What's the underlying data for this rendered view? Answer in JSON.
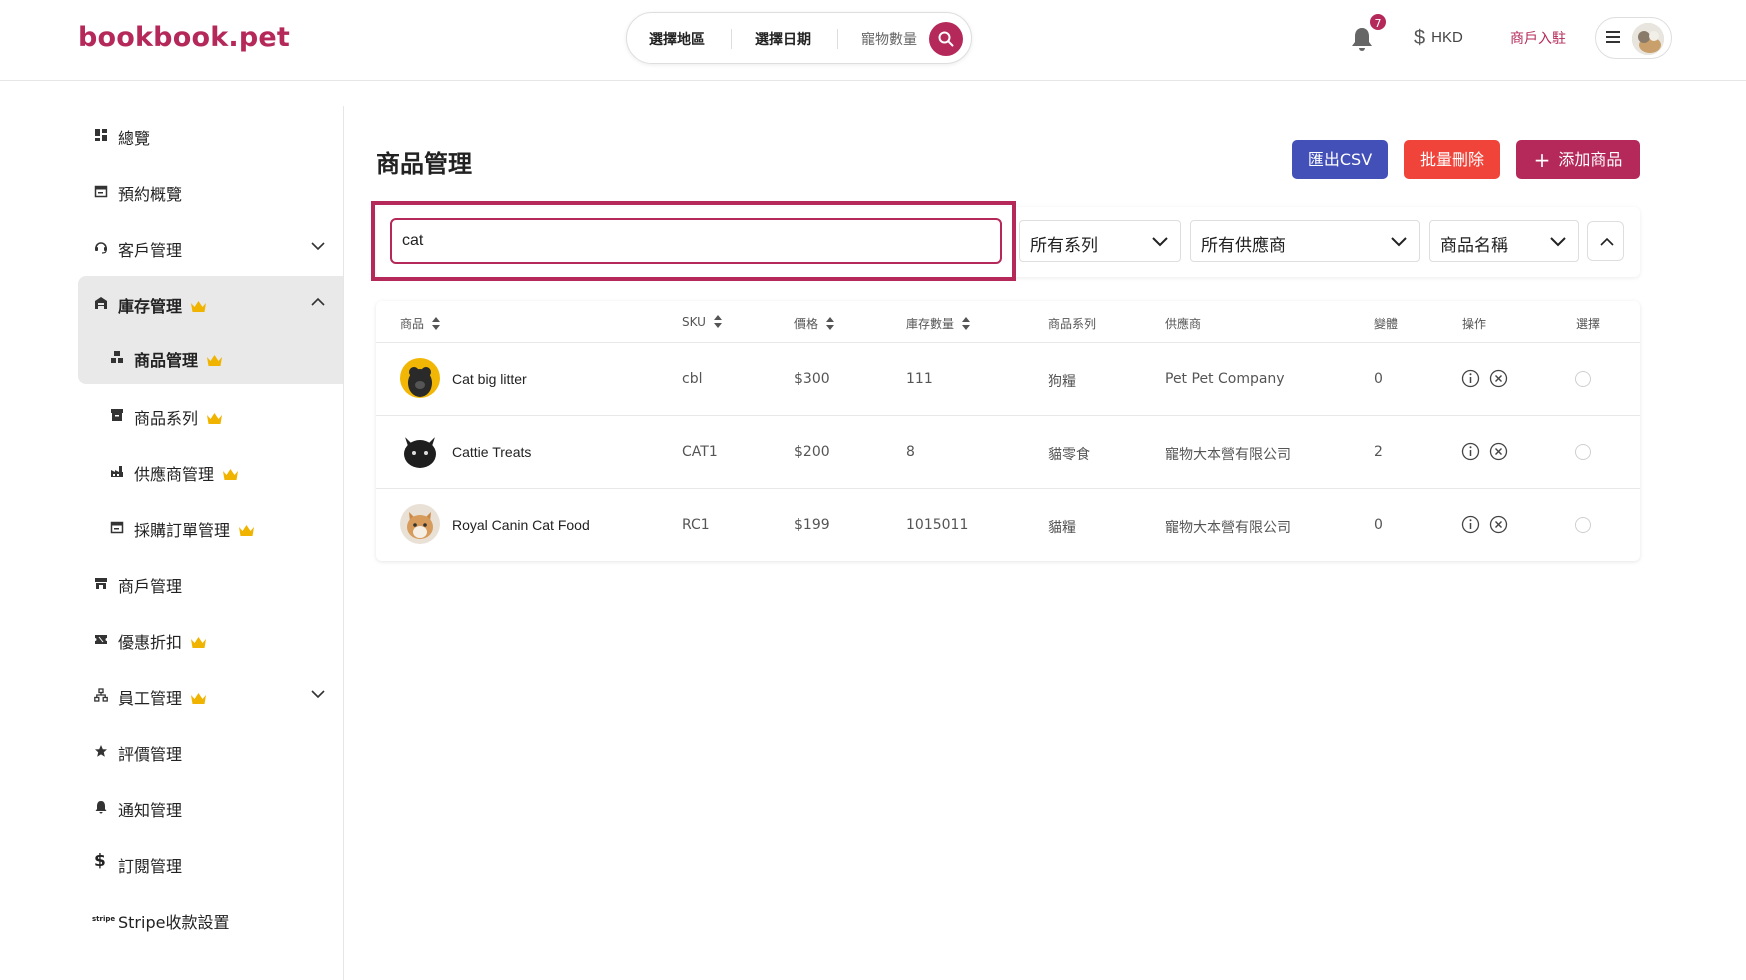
{
  "header": {
    "logo": "bookbook.pet",
    "search": {
      "region_label": "選擇地區",
      "date_label": "選擇日期",
      "pets_label": "寵物數量"
    },
    "notification_count": "7",
    "currency": "HKD",
    "merchant_link": "商戶入駐"
  },
  "sidebar": {
    "items": [
      {
        "label": "總覽",
        "icon": "dashboard-icon"
      },
      {
        "label": "預約概覽",
        "icon": "calendar-icon"
      },
      {
        "label": "客戶管理",
        "icon": "headset-icon"
      },
      {
        "label": "庫存管理",
        "icon": "warehouse-icon"
      },
      {
        "label": "商品管理",
        "icon": "boxes-icon"
      },
      {
        "label": "商品系列",
        "icon": "archive-icon"
      },
      {
        "label": "供應商管理",
        "icon": "factory-icon"
      },
      {
        "label": "採購訂單管理",
        "icon": "calendar-icon"
      },
      {
        "label": "商戶管理",
        "icon": "store-icon"
      },
      {
        "label": "優惠折扣",
        "icon": "ticket-icon"
      },
      {
        "label": "員工管理",
        "icon": "org-chart-icon"
      },
      {
        "label": "評價管理",
        "icon": "star-icon"
      },
      {
        "label": "通知管理",
        "icon": "bell-icon"
      },
      {
        "label": "訂閱管理",
        "icon": "dollar-icon"
      },
      {
        "label": "Stripe收款設置",
        "icon": "stripe-icon"
      }
    ]
  },
  "main": {
    "title": "商品管理",
    "buttons": {
      "export_csv": "匯出CSV",
      "bulk_delete": "批量刪除",
      "add_product": "添加商品"
    },
    "filters": {
      "search_value": "cat",
      "series": "所有系列",
      "supplier": "所有供應商",
      "sort_field": "商品名稱"
    },
    "table": {
      "headers": {
        "product": "商品",
        "sku": "SKU",
        "price": "價格",
        "stock": "庫存數量",
        "series": "商品系列",
        "supplier": "供應商",
        "variants": "變體",
        "actions": "操作",
        "select": "選擇"
      },
      "rows": [
        {
          "name": "Cat big litter",
          "sku": "cbl",
          "price": "$300",
          "stock": "111",
          "series": "狗糧",
          "supplier": "Pet Pet Company",
          "variants": "0"
        },
        {
          "name": "Cattie Treats",
          "sku": "CAT1",
          "price": "$200",
          "stock": "8",
          "series": "貓零食",
          "supplier": "寵物大本營有限公司",
          "variants": "2"
        },
        {
          "name": "Royal Canin Cat Food",
          "sku": "RC1",
          "price": "$199",
          "stock": "1015011",
          "series": "貓糧",
          "supplier": "寵物大本營有限公司",
          "variants": "0"
        }
      ]
    }
  },
  "colors": {
    "brand": "#b5295a",
    "csv_button": "#4350b8",
    "delete_button": "#f0443b",
    "crown": "#f0b400"
  }
}
